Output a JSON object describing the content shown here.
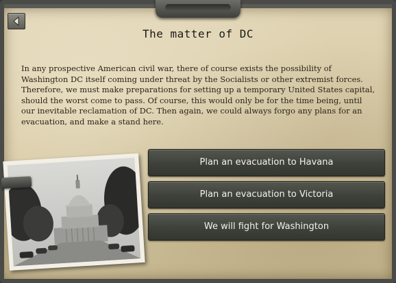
{
  "event": {
    "title": "The matter of DC",
    "description": "In any prospective American civil war, there of course exists the possibility of Washington DC itself coming under threat by the Socialists or other extremist forces. Therefore, we must make preparations for setting up a temporary United States capital, should the worst come to pass. Of course, this would only be for the time being, until our inevitable reclamation of DC. Then again, we could always forgo any plans for an evacuation, and make a stand here.",
    "options": [
      {
        "label": "Plan an evacuation to Havana"
      },
      {
        "label": "Plan an evacuation to Victoria"
      },
      {
        "label": "We will fight for Washington"
      }
    ]
  },
  "icons": {
    "back": "back-arrow-icon"
  },
  "colors": {
    "paper": "#d6c8a4",
    "frame": "#4a4b47",
    "button": "#3e413a",
    "button_text": "#f3f2ea"
  }
}
